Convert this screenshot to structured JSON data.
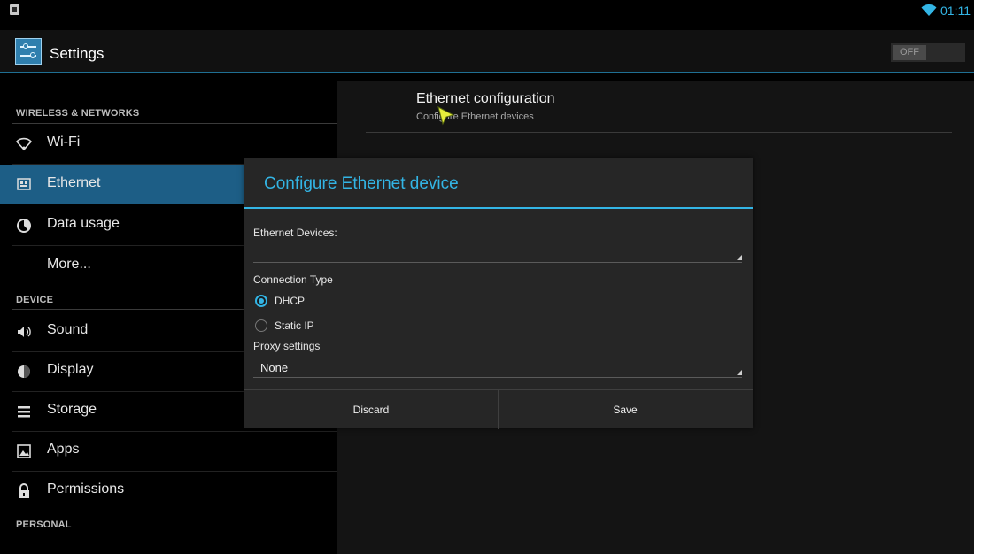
{
  "status_bar": {
    "time": "01:11"
  },
  "action_bar": {
    "title": "Settings",
    "toggle": "OFF"
  },
  "sidebar": {
    "headers": {
      "wireless": "WIRELESS & NETWORKS",
      "device": "DEVICE",
      "personal": "PERSONAL"
    },
    "items": [
      {
        "label": "Wi-Fi",
        "icon": "wifi-icon"
      },
      {
        "label": "Ethernet",
        "icon": "ethernet-icon",
        "selected": true
      },
      {
        "label": "Data usage",
        "icon": "data-usage-icon"
      },
      {
        "label": "More...",
        "icon": ""
      },
      {
        "label": "Sound",
        "icon": "sound-icon"
      },
      {
        "label": "Display",
        "icon": "display-icon"
      },
      {
        "label": "Storage",
        "icon": "storage-icon"
      },
      {
        "label": "Apps",
        "icon": "apps-icon"
      },
      {
        "label": "Permissions",
        "icon": "lock-icon"
      }
    ]
  },
  "pane": {
    "pref_title": "Ethernet configuration",
    "pref_summary": "Configure Ethernet devices"
  },
  "dialog": {
    "title": "Configure Ethernet device",
    "devices_label": "Ethernet Devices:",
    "devices_value": "",
    "connection_type_label": "Connection Type",
    "options": [
      "DHCP",
      "Static IP"
    ],
    "selected_option": "DHCP",
    "proxy_label": "Proxy settings",
    "proxy_value": "None",
    "discard": "Discard",
    "save": "Save"
  },
  "colors": {
    "accent": "#33b5e5",
    "selected": "#1d5e86"
  }
}
